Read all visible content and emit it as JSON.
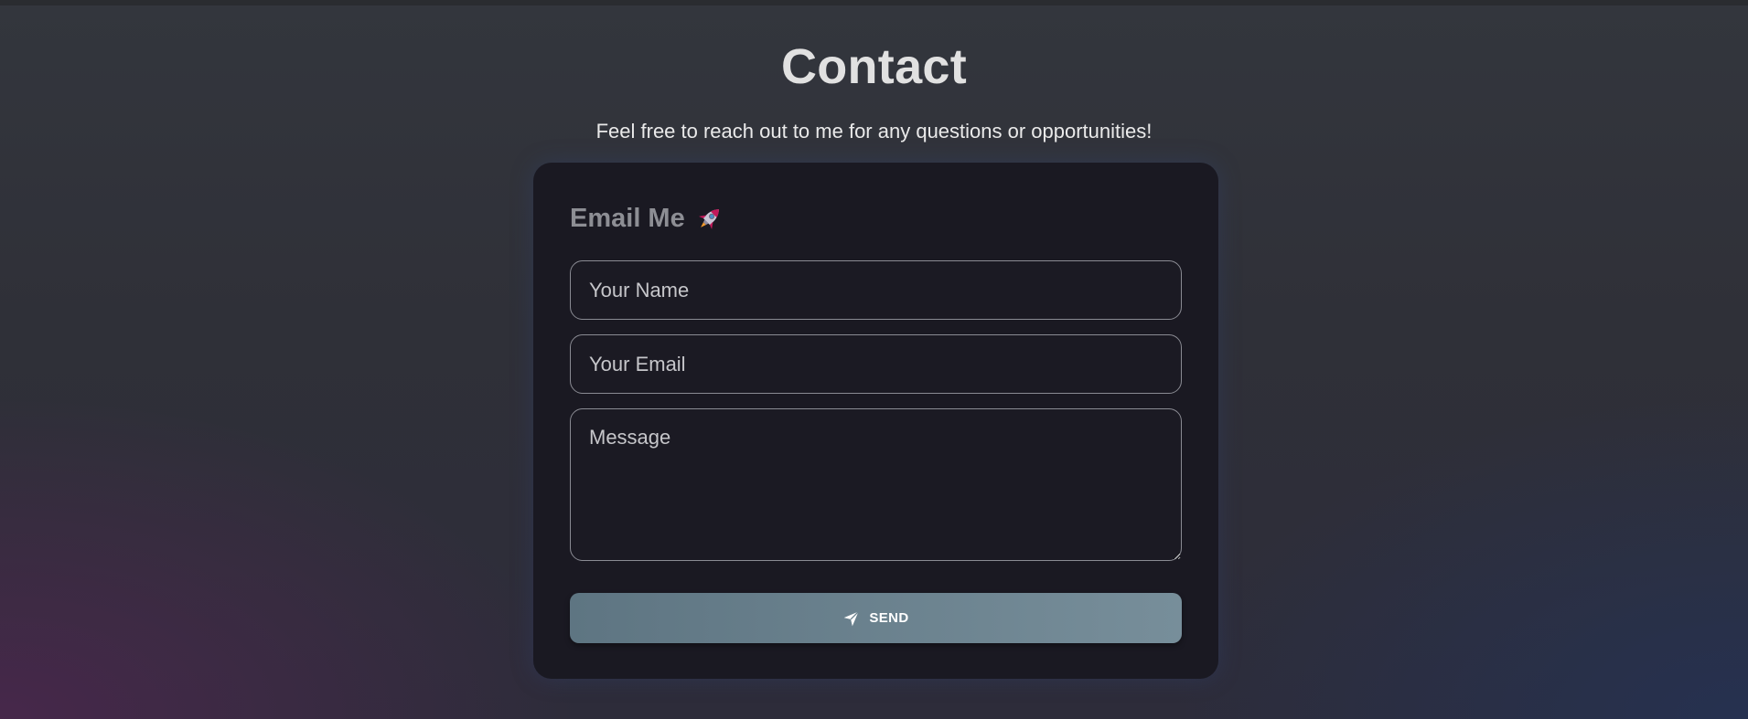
{
  "header": {
    "title": "Contact",
    "subtitle": "Feel free to reach out to me for any questions or opportunities!"
  },
  "form": {
    "title": "Email Me",
    "title_icon": "rocket-icon",
    "name_field": {
      "placeholder": "Your Name",
      "value": ""
    },
    "email_field": {
      "placeholder": "Your Email",
      "value": ""
    },
    "message_field": {
      "placeholder": "Message",
      "value": ""
    },
    "send_button": {
      "label": "SEND",
      "icon": "paper-plane-icon"
    }
  },
  "colors": {
    "card_background": "#1a1922",
    "button_gradient_start": "#5e7582",
    "button_gradient_end": "#778e9a",
    "field_border": "#8a8b93",
    "card_title": "#8d8e94"
  }
}
